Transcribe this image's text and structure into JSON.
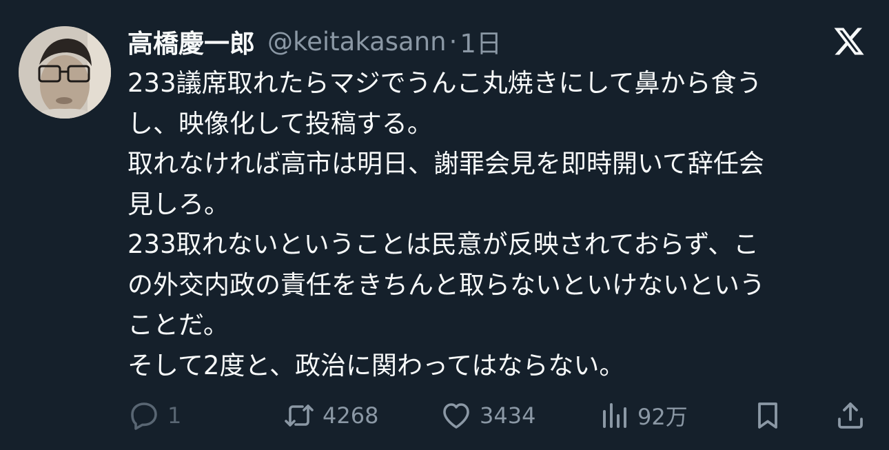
{
  "author": {
    "display_name": "高橋慶一郎",
    "handle": "@keitakasann",
    "separator": "·",
    "time": "1日"
  },
  "brand_icon": "x-logo-icon",
  "text_lines": [
    "233議席取れたらマジでうんこ丸焼きにして鼻から食う",
    "し、映像化して投稿する。",
    "取れなければ高市は明日、謝罪会見を即時開いて辞任会",
    "見しろ。",
    "233取れないということは民意が反映されておらず、こ",
    "の外交内政の責任をきちんと取らないといけないという",
    "ことだ。",
    "そして2度と、政治に関わってはならない。"
  ],
  "actions": {
    "reply": {
      "icon": "reply-icon",
      "count": "1"
    },
    "retweet": {
      "icon": "retweet-icon",
      "count": "4268"
    },
    "like": {
      "icon": "heart-icon",
      "count": "3434"
    },
    "views": {
      "icon": "views-icon",
      "count": "92万"
    },
    "bookmark": {
      "icon": "bookmark-icon"
    },
    "share": {
      "icon": "share-icon"
    }
  },
  "colors": {
    "background": "#15202b",
    "text_primary": "#f7f9f9",
    "text_secondary": "#8b98a5"
  }
}
